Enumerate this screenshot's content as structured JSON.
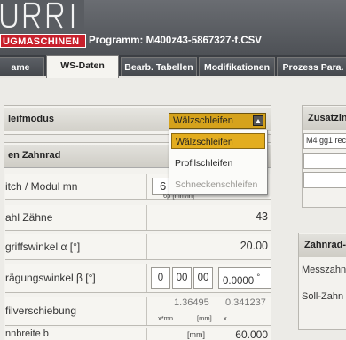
{
  "header": {
    "logo_text": "URRI",
    "brand": "UGMASCHINEN",
    "program_label": "Programm:",
    "program_file": "M400z43-5867327-f.CSV"
  },
  "tabs": [
    {
      "label": "ame"
    },
    {
      "label": "WS-Daten"
    },
    {
      "label": "Bearb. Tabellen"
    },
    {
      "label": "Modifikationen"
    },
    {
      "label": "Prozess Para."
    }
  ],
  "schleifmodus": {
    "label": "leifmodus",
    "selected": "Wälzschleifen",
    "options": [
      {
        "label": "Wälzschleifen"
      },
      {
        "label": "Profilschleifen"
      },
      {
        "label": "Schneckenschleifen"
      }
    ]
  },
  "zahnrad": {
    "heading": "en Zahnrad",
    "rows": [
      {
        "label": "itch / Modul mn",
        "value": "6",
        "unit": "6p [mm/in]"
      },
      {
        "label": "ahl Zähne",
        "value": "43"
      },
      {
        "label": "griffswinkel α [°]",
        "value": "20.00"
      },
      {
        "label": "rägungswinkel β [°]",
        "deg": "0",
        "min": "00",
        "sec": "00",
        "value": "0.0000",
        "value_unit": "°"
      },
      {
        "label": "filverschiebung",
        "value1": "1.36495",
        "sub1": "x*mn",
        "sub1b": "[mm]",
        "value2": "0.341237",
        "sub2": "x"
      },
      {
        "label": "nnbreite b",
        "unit": "[mm]",
        "value": "60.000"
      }
    ]
  },
  "right_panel_top": {
    "heading": "Zusatzin",
    "value": "M4 gg1 rec"
  },
  "right_panel_bottom": {
    "heading": "Zahnrad-",
    "rows": [
      {
        "label": "Messzahn"
      },
      {
        "label": "Soll-Zahn"
      }
    ]
  },
  "colors": {
    "brand_red": "#c8202c",
    "dropdown_accent": "#d5a21c"
  }
}
